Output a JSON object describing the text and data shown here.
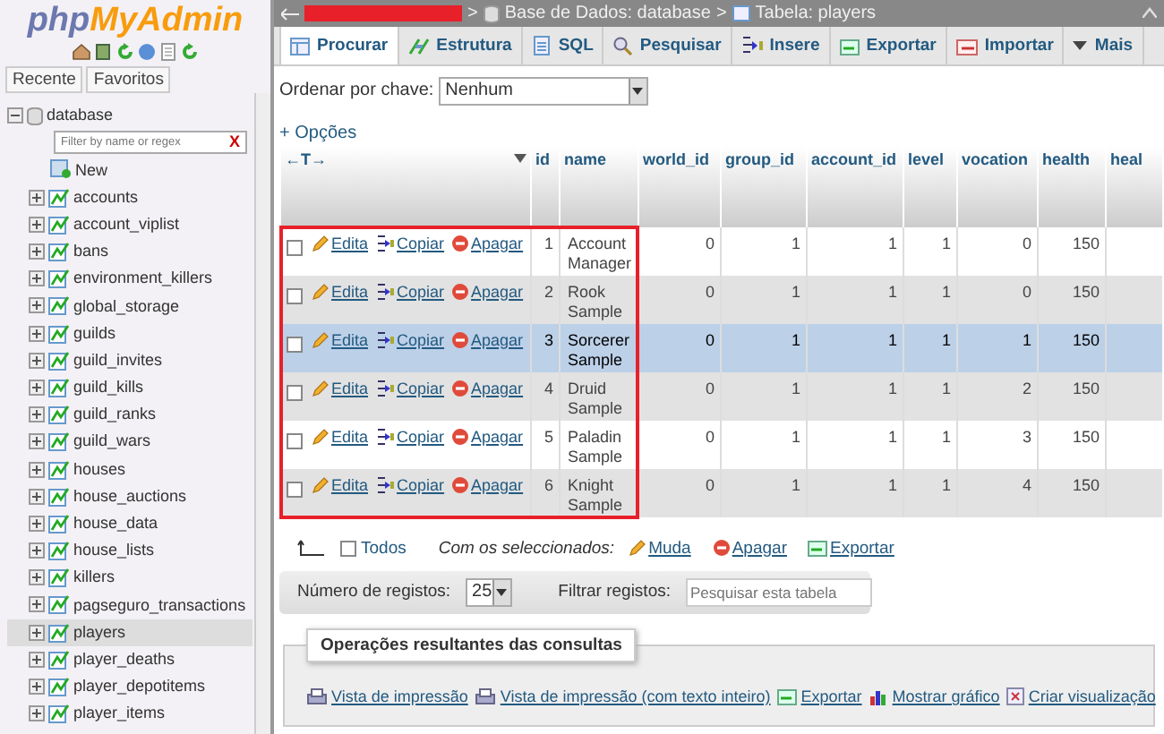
{
  "logo": {
    "php": "php",
    "name": "MyAdmin"
  },
  "sidebar": {
    "tabs": [
      "Recente",
      "Favoritos"
    ],
    "database": "database",
    "filter_placeholder": "Filter by name or regex",
    "clear": "X",
    "new_label": "New",
    "tables": [
      {
        "name": "accounts",
        "selected": false
      },
      {
        "name": "account_viplist",
        "selected": false
      },
      {
        "name": "bans",
        "selected": false
      },
      {
        "name": "environment_killers",
        "selected": false
      },
      {
        "name": "global_storage",
        "selected": false
      },
      {
        "name": "guilds",
        "selected": false
      },
      {
        "name": "guild_invites",
        "selected": false
      },
      {
        "name": "guild_kills",
        "selected": false
      },
      {
        "name": "guild_ranks",
        "selected": false
      },
      {
        "name": "guild_wars",
        "selected": false
      },
      {
        "name": "houses",
        "selected": false
      },
      {
        "name": "house_auctions",
        "selected": false
      },
      {
        "name": "house_data",
        "selected": false
      },
      {
        "name": "house_lists",
        "selected": false
      },
      {
        "name": "killers",
        "selected": false
      },
      {
        "name": "pagseguro_transactions",
        "selected": false
      },
      {
        "name": "players",
        "selected": true
      },
      {
        "name": "player_deaths",
        "selected": false
      },
      {
        "name": "player_depotitems",
        "selected": false
      },
      {
        "name": "player_items",
        "selected": false
      }
    ]
  },
  "breadcrumb": [
    {
      "kind": "redacted"
    },
    {
      "kind": "database",
      "prefix": ">",
      "text": "Base de Dados: database"
    },
    {
      "kind": "table",
      "prefix": ">",
      "text": "Tabela: players"
    }
  ],
  "tabs": [
    {
      "label": "Procurar",
      "selected": true
    },
    {
      "label": "Estrutura",
      "selected": false
    },
    {
      "label": "SQL",
      "selected": false
    },
    {
      "label": "Pesquisar",
      "selected": false
    },
    {
      "label": "Insere",
      "selected": false
    },
    {
      "label": "Exportar",
      "selected": false
    },
    {
      "label": "Importar",
      "selected": false
    },
    {
      "label": "Mais",
      "selected": false
    }
  ],
  "sort": {
    "label": "Ordenar por chave:",
    "value": "Nenhum"
  },
  "options_link": "+ Opções",
  "table": {
    "sort_arrows": "←T→",
    "columns": [
      "id",
      "name",
      "world_id",
      "group_id",
      "account_id",
      "level",
      "vocation",
      "health",
      "heal"
    ],
    "rows": [
      {
        "actions": [
          "Edita",
          "Copiar",
          "Apagar"
        ],
        "cells": [
          "1",
          "Account Manager",
          "0",
          "1",
          "1",
          "1",
          "0",
          "150"
        ],
        "highlighted": false,
        "checked": false
      },
      {
        "actions": [
          "Edita",
          "Copiar",
          "Apagar"
        ],
        "cells": [
          "2",
          "Rook Sample",
          "0",
          "1",
          "1",
          "1",
          "0",
          "150"
        ],
        "highlighted": false,
        "checked": false
      },
      {
        "actions": [
          "Edita",
          "Copiar",
          "Apagar"
        ],
        "cells": [
          "3",
          "Sorcerer Sample",
          "0",
          "1",
          "1",
          "1",
          "1",
          "150"
        ],
        "highlighted": true,
        "checked": false
      },
      {
        "actions": [
          "Edita",
          "Copiar",
          "Apagar"
        ],
        "cells": [
          "4",
          "Druid Sample",
          "0",
          "1",
          "1",
          "1",
          "2",
          "150"
        ],
        "highlighted": false,
        "checked": false
      },
      {
        "actions": [
          "Edita",
          "Copiar",
          "Apagar"
        ],
        "cells": [
          "5",
          "Paladin Sample",
          "0",
          "1",
          "1",
          "1",
          "3",
          "150"
        ],
        "highlighted": false,
        "checked": false
      },
      {
        "actions": [
          "Edita",
          "Copiar",
          "Apagar"
        ],
        "cells": [
          "6",
          "Knight Sample",
          "0",
          "1",
          "1",
          "1",
          "4",
          "150"
        ],
        "highlighted": false,
        "checked": false
      }
    ]
  },
  "bulk": {
    "checked": false,
    "all": "Todos",
    "with_selected": "Com os seleccionados:",
    "actions": [
      "Muda",
      "Apagar",
      "Exportar"
    ]
  },
  "paging": {
    "rows_label": "Número de registos:",
    "rows_value": "25",
    "filter_label": "Filtrar registos:",
    "filter_placeholder": "Pesquisar esta tabela"
  },
  "operations": {
    "title": "Operações resultantes das consultas",
    "links": [
      "Vista de impressão",
      "Vista de impressão (com texto inteiro)",
      "Exportar",
      "Mostrar gráfico",
      "Criar visualização"
    ]
  }
}
